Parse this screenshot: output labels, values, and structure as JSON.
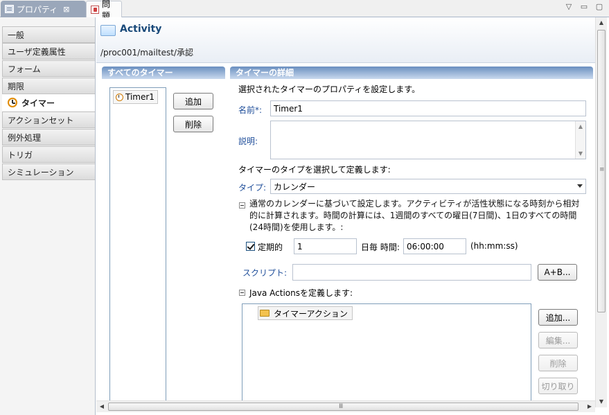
{
  "tabs": {
    "properties": "プロパティ",
    "properties_close": "⊠",
    "problems": "問題"
  },
  "window_controls": [
    "▽",
    "▭",
    "▢"
  ],
  "nav": {
    "items": [
      {
        "label": "一般"
      },
      {
        "label": "ユーザ定義属性"
      },
      {
        "label": "フォーム"
      },
      {
        "label": "期限"
      },
      {
        "label": "タイマー",
        "selected": true
      },
      {
        "label": "アクションセット"
      },
      {
        "label": "例外処理"
      },
      {
        "label": "トリガ"
      },
      {
        "label": "シミュレーション"
      }
    ]
  },
  "header": {
    "title": "Activity",
    "path": "/proc001/mailtest/承認"
  },
  "timers_panel": {
    "title": "すべてのタイマー",
    "items": [
      "Timer1"
    ],
    "add_label": "追加",
    "delete_label": "削除"
  },
  "details": {
    "title": "タイマーの詳細",
    "intro": "選択されたタイマーのプロパティを設定します。",
    "name_label": "名前*:",
    "name_value": "Timer1",
    "desc_label": "説明:",
    "desc_value": "",
    "type_prompt": "タイマーのタイプを選択して定義します:",
    "type_label": "タイプ:",
    "type_value": "カレンダー",
    "calendar_desc": "通常のカレンダーに基づいて設定します。アクティビティが活性状態になる時刻から相対的に計算されます。時間の計算には、1週間のすべての曜日(7日間)、1日のすべての時間(24時間)を使用します。:",
    "periodic_label": "定期的",
    "periodic_checked": true,
    "period_value": "1",
    "every_day_label": "日毎 時間:",
    "time_value": "06:00:00",
    "time_format": "(hh:mm:ss)",
    "script_label": "スクリプト:",
    "script_value": "",
    "script_button": "A+B...",
    "java_actions_label": "Java Actionsを定義します:",
    "actions": [
      "タイマーアクション"
    ],
    "action_buttons": {
      "add": "追加...",
      "edit": "編集...",
      "delete": "削除",
      "cut": "切り取り"
    }
  },
  "scroll": {
    "up": "▲",
    "down": "▼",
    "left": "◀",
    "right": "▶",
    "grip_v": "≡",
    "grip_h": "Ⅲ"
  }
}
